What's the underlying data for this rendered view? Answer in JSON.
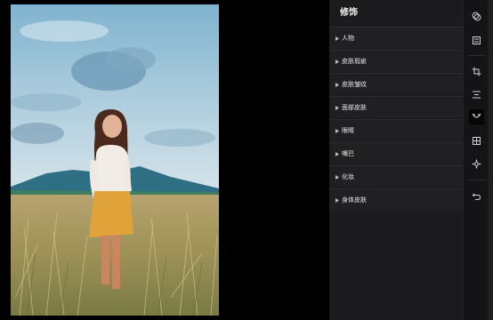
{
  "panel": {
    "title": "修饰",
    "items": [
      {
        "label": "人物"
      },
      {
        "label": "皮肤瑕疵"
      },
      {
        "label": "皮肤皱纹"
      },
      {
        "label": "面部皮肤"
      },
      {
        "label": "眼睛"
      },
      {
        "label": "嘴巴"
      },
      {
        "label": "化妆"
      },
      {
        "label": "身体皮肤"
      }
    ]
  },
  "rail": {
    "icons": [
      "filter-circles-icon",
      "adjust-lines-icon",
      "crop-icon",
      "align-icon",
      "portrait-retouch-icon",
      "layers-icon",
      "magic-wand-icon",
      "undo-icon"
    ],
    "active": "portrait-retouch-icon"
  },
  "colors": {
    "panel_bg": "#1b1b1d",
    "item_bg": "#202022",
    "rail_bg": "#141416",
    "canvas_bg": "#000000"
  }
}
